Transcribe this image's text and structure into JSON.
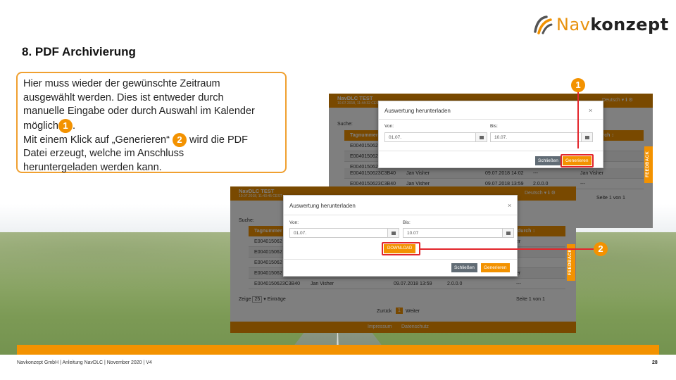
{
  "brand": {
    "logo_nav": "Nav",
    "logo_konzept": "konzept",
    "accent": "#f39200",
    "highlight": "#e3262c"
  },
  "title": "8. PDF Archivierung",
  "description": {
    "line1": "Hier muss wieder der gewünschte Zeitraum",
    "line2": "ausgewählt werden. Dies ist entweder durch",
    "line3": "manuelle Eingabe oder durch Auswahl im Kalender",
    "line4_text": "möglich",
    "line4_badge": "1",
    "line4_end": ".",
    "line5_text": "Mit einem Klick auf „Generieren“",
    "line5_badge": "2",
    "line5_end": "wird die PDF",
    "line6": "Datei erzeugt, welche im Anschluss",
    "line7": "heruntergeladen werden kann."
  },
  "screenshot_back": {
    "app_name": "NavDLC TEST",
    "app_date": "10.07.2018, 11:44:32 CEST",
    "nav_right": "Deutsch ▾  ℹ  ⚙",
    "search_label": "Suche:",
    "col_first": "Tagnummer",
    "col_last": "durch ↕",
    "rows": [
      {
        "c1": "E004015062",
        "c2": "",
        "c3": "",
        "c4": "",
        "c5": "er"
      },
      {
        "c1": "E004015062",
        "c2": "",
        "c3": "",
        "c4": "",
        "c5": ""
      },
      {
        "c1": "E004015062",
        "c2": "",
        "c3": "",
        "c4": "",
        "c5": ""
      },
      {
        "c1": "E0040150623C3B40",
        "c2": "Jan Visher",
        "c3": "09.07.2018 14:02",
        "c4": "---",
        "c5": "Jan Visher"
      },
      {
        "c1": "E0040150623C3B40",
        "c2": "Jan Visher",
        "c3": "09.07.2018 13:59",
        "c4": "2.0.0.0",
        "c5": "---"
      }
    ],
    "page_info": "Seite 1 von 1",
    "feedback": "FEEDBACK",
    "modal": {
      "title": "Auswertung herunterladen",
      "close": "×",
      "from_label": "Von:",
      "from_value": "01.07.",
      "to_label": "Bis:",
      "to_value": "10.07.",
      "btn_close": "Schließen",
      "btn_generate": "Generieren"
    },
    "callout": "1"
  },
  "screenshot_front": {
    "app_name": "NavDLC TEST",
    "app_date": "10.07.2018, 11:43:45 CEST",
    "nav_right": "Deutsch ▾  ℹ  ⚙",
    "search_label": "Suche:",
    "col_first": "Tagnummer",
    "col_last": "durch ↕",
    "rows": [
      {
        "c1": "E004015062",
        "c2": "",
        "c3": "",
        "c4": "",
        "c5": "er"
      },
      {
        "c1": "E004015062",
        "c2": "",
        "c3": "",
        "c4": "",
        "c5": ""
      },
      {
        "c1": "E004015062",
        "c2": "",
        "c3": "",
        "c4": "",
        "c5": ""
      },
      {
        "c1": "E004015062",
        "c2": "",
        "c3": "",
        "c4": "",
        "c5": "er"
      },
      {
        "c1": "E0040150623C3B40",
        "c2": "Jan Visher",
        "c3": "09.07.2018 13:59",
        "c4": "2.0.0.0",
        "c5": "---"
      }
    ],
    "entries_label": "Zeige",
    "entries_value": "25",
    "entries_suffix": "Einträge",
    "page_info": "Seite 1 von 1",
    "pager_prev": "Zurück",
    "pager_current": "1",
    "pager_next": "Weiter",
    "footer_link1": "Impressum",
    "footer_link2": "Datenschutz",
    "feedback": "FEEDBACK",
    "modal": {
      "title": "Auswertung herunterladen",
      "close": "×",
      "from_label": "Von:",
      "from_value": "01.07.",
      "to_label": "Bis:",
      "to_value": "10.07",
      "btn_download": "DOWNLOAD",
      "btn_close": "Schließen",
      "btn_generate": "Generieren"
    },
    "callout": "2"
  },
  "footer": {
    "text": "Navkonzept GmbH  |  Anleitung NavDLC  |  November 2020  |  V4",
    "page": "28"
  }
}
